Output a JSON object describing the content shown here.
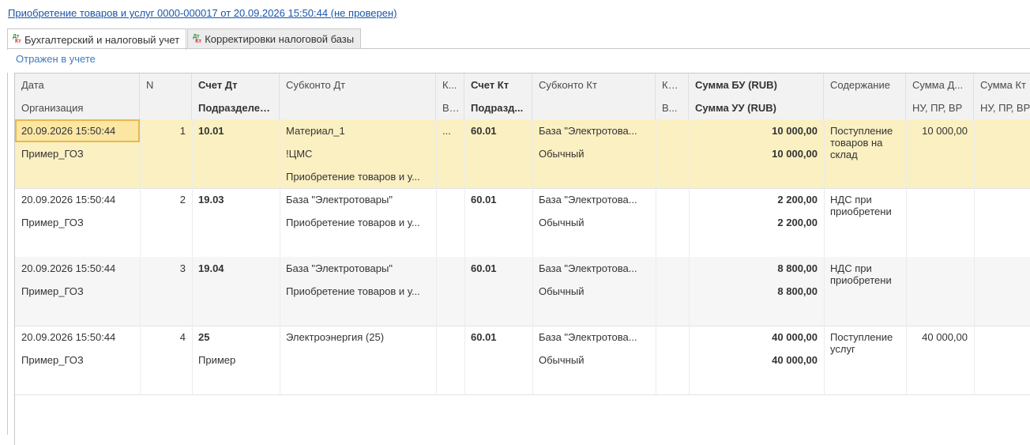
{
  "document": {
    "title_link": "Приобретение товаров и услуг 0000-000017 от 20.09.2026 15:50:44 (не проверен)"
  },
  "tabs": [
    {
      "label": "Бухгалтерский и налоговый учет",
      "active": true
    },
    {
      "label": "Корректировки налоговой базы",
      "active": false
    }
  ],
  "tab_icon": {
    "dt": "Дт",
    "kt": "Кт"
  },
  "status": "Отражен в учете",
  "header": {
    "row1": [
      "Дата",
      "N",
      "Счет Дт",
      "Субконто Дт",
      "К...",
      "Счет Кт",
      "Субконто Кт",
      "Ко...",
      "Сумма БУ (RUB)",
      "Содержание",
      "Сумма Д...",
      "Сумма Кт"
    ],
    "row2": [
      "Организация",
      "",
      "Подразделен...",
      "",
      "В...",
      "Подразд...",
      "",
      "В...",
      "Сумма УУ (RUB)",
      "",
      "НУ, ПР, ВР",
      "НУ, ПР, ВР"
    ]
  },
  "rows": [
    {
      "date": "20.09.2026 15:50:44",
      "n": "1",
      "acc_dt": "10.01",
      "sub_dt": [
        "Материал_1",
        "!ЦМС",
        "Приобретение товаров и у..."
      ],
      "k": "...",
      "acc_kt": "60.01",
      "sub_kt": [
        "База \"Электротова...",
        "Обычный"
      ],
      "sum_bu": "10 000,00",
      "sum_uu": "10 000,00",
      "content": "Поступление товаров на склад",
      "sum_d_nu": "10 000,00",
      "org": "Пример_ГОЗ",
      "dept": ""
    },
    {
      "date": "20.09.2026 15:50:44",
      "n": "2",
      "acc_dt": "19.03",
      "sub_dt": [
        "База \"Электротовары\"",
        "Приобретение товаров и у..."
      ],
      "k": "",
      "acc_kt": "60.01",
      "sub_kt": [
        "База \"Электротова...",
        "Обычный"
      ],
      "sum_bu": "2 200,00",
      "sum_uu": "2 200,00",
      "content": "НДС при приобретени",
      "sum_d_nu": "",
      "org": "Пример_ГОЗ",
      "dept": ""
    },
    {
      "date": "20.09.2026 15:50:44",
      "n": "3",
      "acc_dt": "19.04",
      "sub_dt": [
        "База \"Электротовары\"",
        "Приобретение товаров и у..."
      ],
      "k": "",
      "acc_kt": "60.01",
      "sub_kt": [
        "База \"Электротова...",
        "Обычный"
      ],
      "sum_bu": "8 800,00",
      "sum_uu": "8 800,00",
      "content": "НДС при приобретени",
      "sum_d_nu": "",
      "org": "Пример_ГОЗ",
      "dept": ""
    },
    {
      "date": "20.09.2026 15:50:44",
      "n": "4",
      "acc_dt": "25",
      "sub_dt": [
        "Электроэнергия (25)",
        ""
      ],
      "k": "",
      "acc_kt": "60.01",
      "sub_kt": [
        "База \"Электротова...",
        "Обычный"
      ],
      "sum_bu": "40 000,00",
      "sum_uu": "40 000,00",
      "content": "Поступление услуг",
      "sum_d_nu": "40 000,00",
      "org": "Пример_ГОЗ",
      "dept": "Пример"
    }
  ],
  "colors": {
    "link": "#1a56a8",
    "status": "#3f7bbd",
    "selected_row": "#fbf0c2",
    "header_bg": "#f2f2f2"
  }
}
